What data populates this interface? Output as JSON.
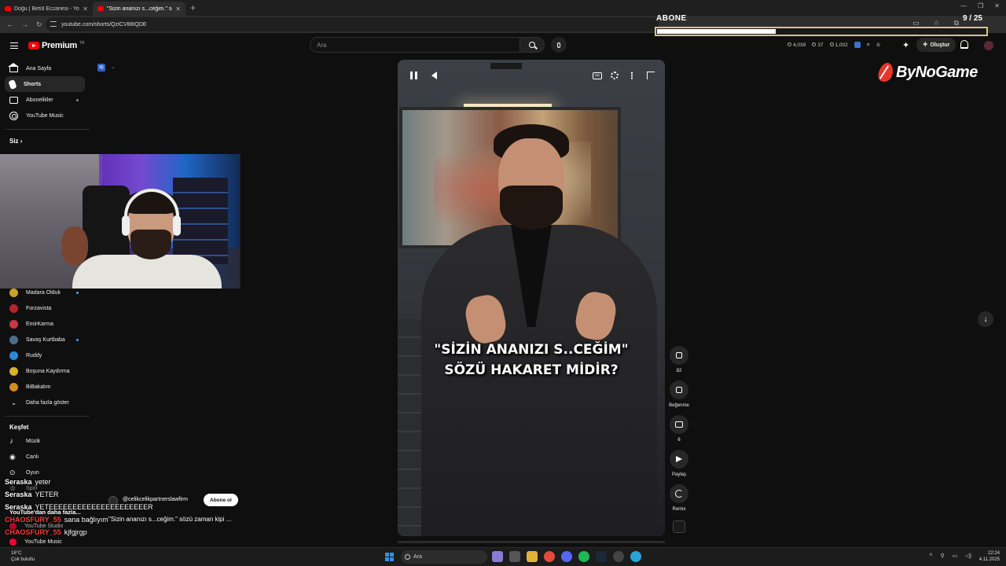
{
  "browser": {
    "tabs": [
      {
        "label": "Doğu | Betül Eczanesi - YouTube",
        "active": false
      },
      {
        "label": "\"Sizin ananızı s...ceğim.\" söz",
        "active": true
      }
    ],
    "url": "youtube.com/shorts/QzICV88IQDE"
  },
  "goal": {
    "title": "ABONE",
    "count": "9 / 25",
    "progress": 0.36
  },
  "header": {
    "logo_text": "Premium",
    "logo_sup": "TR",
    "search_placeholder": "Ara",
    "stats": [
      "4,039",
      "37",
      "1,002"
    ],
    "create_label": "Oluştur"
  },
  "brand": {
    "name": "ByNoGame"
  },
  "sidebar": {
    "main": [
      {
        "label": "Ana Sayfa",
        "icon": "home-icon"
      },
      {
        "label": "Shorts",
        "icon": "shorts-icon",
        "active": true
      },
      {
        "label": "Abonelikler",
        "icon": "subscriptions-icon"
      },
      {
        "label": "YouTube Music",
        "icon": "music-icon"
      }
    ],
    "you_label": "Siz",
    "subscriptions": [
      {
        "label": "Madara Olduk",
        "color": "#c9a227",
        "dot": true
      },
      {
        "label": "Forzavista",
        "color": "#b2252c"
      },
      {
        "label": "EmirKarma",
        "color": "#c53a46"
      },
      {
        "label": "Savaş Kurtbaba",
        "color": "#4e6c8a",
        "dot": true
      },
      {
        "label": "Ruddy",
        "color": "#2a8bd8"
      },
      {
        "label": "Boşuna Kaydırma",
        "color": "#d9b12c"
      },
      {
        "label": "BiBakalım",
        "color": "#d08a22"
      }
    ],
    "show_more": "Daha fazla göster",
    "explore_title": "Keşfet",
    "explore": [
      {
        "label": "Müzik",
        "icon": "music-note-icon"
      },
      {
        "label": "Canlı",
        "icon": "live-icon"
      },
      {
        "label": "Oyun",
        "icon": "gaming-icon"
      },
      {
        "label": "Spor",
        "icon": "trophy-icon"
      }
    ],
    "more_from": "YouTube'dan daha fazla...",
    "studio": "YouTube Studio",
    "music2": "YouTube Music"
  },
  "video": {
    "caption_line1": "\"SİZİN ANANIZI S..CEĞİM\"",
    "caption_line2": "SÖZÜ HAKARET MİDİR?",
    "channel": "@celikcelikpartnerslawfirm",
    "subscribe": "Abone ol",
    "title": "\"Sizin ananızı s...ceğim.\" sözü zaman kipi ..."
  },
  "actions": {
    "like_count": "82",
    "dislike_label": "Beğenme",
    "comments_count": "6",
    "share_label": "Paylaş",
    "remix_label": "Remix"
  },
  "chat": [
    {
      "user": "Seraska",
      "msg": "yeter",
      "color": "#ffffff"
    },
    {
      "user": "Seraska",
      "msg": "YETER",
      "color": "#ffffff"
    },
    {
      "user": "Seraska",
      "msg": "YETEEEEEEEEEEEEEEEEEEEEER",
      "color": "#ffffff"
    },
    {
      "user": "CHAOSFURY_55",
      "msg": "sana bağlıyım",
      "color": "#ff3b3b"
    },
    {
      "user": "CHAOSFURY_55",
      "msg": "kjfgjrgp",
      "color": "#ff3b3b"
    }
  ],
  "taskbar": {
    "temp": "16°C",
    "weather": "Çok bulutlu",
    "search": "Ara",
    "time": "22:24",
    "date": "4.11.2025"
  },
  "cg_badge": "IQ"
}
